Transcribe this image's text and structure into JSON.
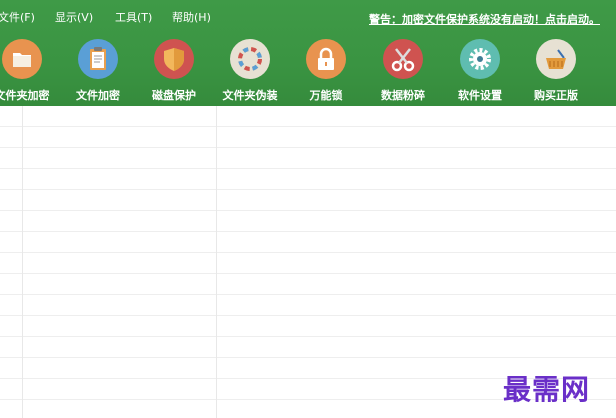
{
  "menu": {
    "file": "文件(F)",
    "view": "显示(V)",
    "tools": "工具(T)",
    "help": "帮助(H)"
  },
  "warning": "警告：加密文件保护系统没有启动！点击启动。",
  "toolbar": [
    {
      "label": "文件夹加密",
      "icon": "folder-icon",
      "color": "#e8934f"
    },
    {
      "label": "文件加密",
      "icon": "clipboard-icon",
      "color": "#5a9fd6"
    },
    {
      "label": "磁盘保护",
      "icon": "shield-icon",
      "color": "#cf5350"
    },
    {
      "label": "文件夹伪装",
      "icon": "color-wheel-icon",
      "color": "#e7e1d3"
    },
    {
      "label": "万能锁",
      "icon": "lock-icon",
      "color": "#e8934f"
    },
    {
      "label": "数据粉碎",
      "icon": "scissors-icon",
      "color": "#cf5350"
    },
    {
      "label": "软件设置",
      "icon": "gear-icon",
      "color": "#5fbdb0"
    },
    {
      "label": "购买正版",
      "icon": "basket-icon",
      "color": "#e7e1d3"
    }
  ],
  "watermark": "最需网"
}
